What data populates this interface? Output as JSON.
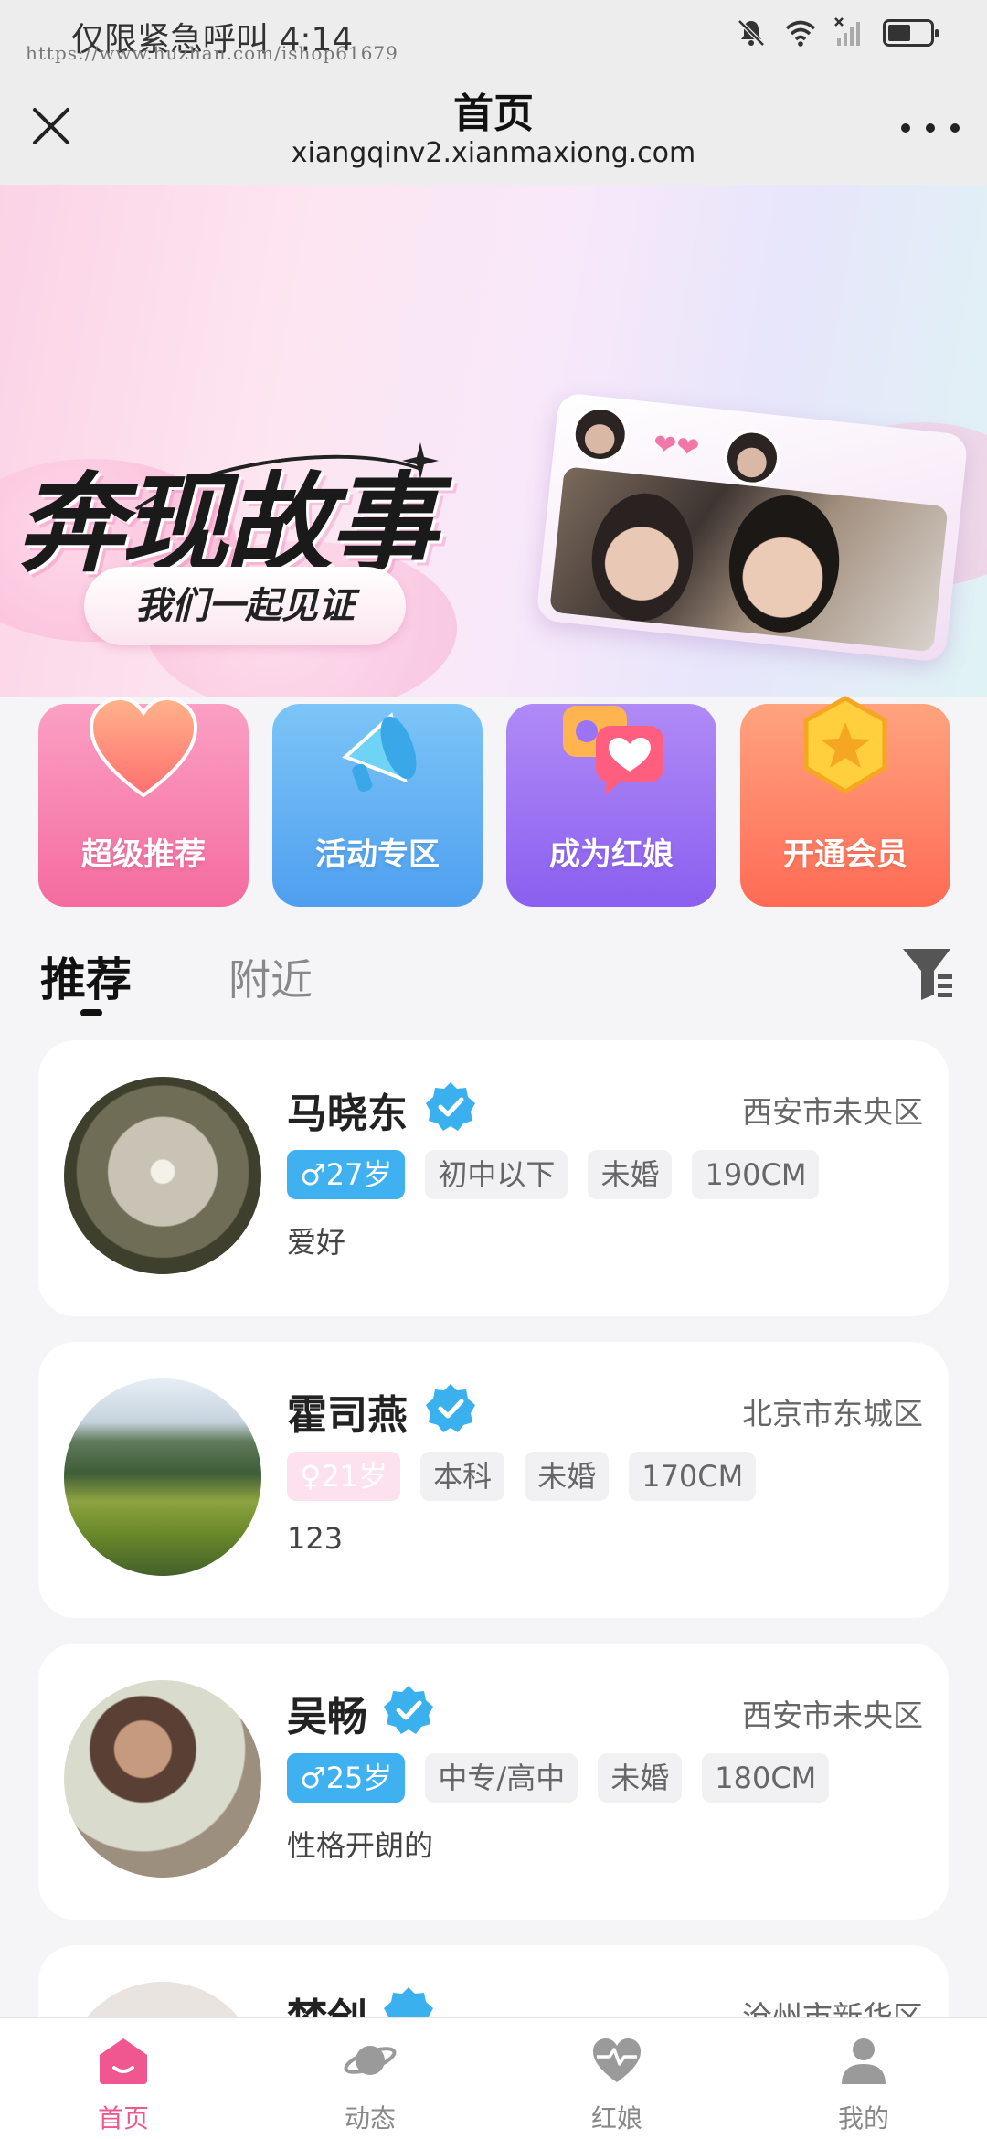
{
  "status_bar": {
    "text": "仅限紧急呼叫 4:14",
    "watermark": "https://www.huzhan.com/ishop61679"
  },
  "header": {
    "title": "首页",
    "url": "xiangqinv2.xianmaxiong.com"
  },
  "banner": {
    "title": "奔现故事",
    "subtitle": "我们一起见证"
  },
  "entries": [
    {
      "label": "超级推荐",
      "color": "#f76fa2"
    },
    {
      "label": "活动专区",
      "color": "#55a7f3"
    },
    {
      "label": "成为红娘",
      "color": "#9c6cf0"
    },
    {
      "label": "开通会员",
      "color": "#ff7a5c"
    }
  ],
  "tabs": {
    "active": "推荐",
    "inactive": "附近"
  },
  "profiles": [
    {
      "name": "马晓东",
      "location": "西安市未央区",
      "gender_age": "♂27岁",
      "gender": "male",
      "tags": [
        "初中以下",
        "未婚",
        "190CM"
      ],
      "bio": "爱好"
    },
    {
      "name": "霍司燕",
      "location": "北京市东城区",
      "gender_age": "♀21岁",
      "gender": "female",
      "tags": [
        "本科",
        "未婚",
        "170CM"
      ],
      "bio": "123"
    },
    {
      "name": "吴畅",
      "location": "西安市未央区",
      "gender_age": "♂25岁",
      "gender": "male",
      "tags": [
        "中专/高中",
        "未婚",
        "180CM"
      ],
      "bio": "性格开朗的"
    },
    {
      "name": "梦创",
      "location": "沧州市新华区"
    }
  ],
  "bottom_nav": [
    {
      "label": "首页",
      "icon": "home-icon",
      "active": true
    },
    {
      "label": "动态",
      "icon": "planet-icon",
      "active": false
    },
    {
      "label": "红娘",
      "icon": "heart-pulse-icon",
      "active": false
    },
    {
      "label": "我的",
      "icon": "user-icon",
      "active": false
    }
  ],
  "colors": {
    "accent": "#f0568f",
    "male_tag": "#3fb0f0",
    "female_tag": "#fde1ee",
    "verify": "#3ab0ee"
  }
}
